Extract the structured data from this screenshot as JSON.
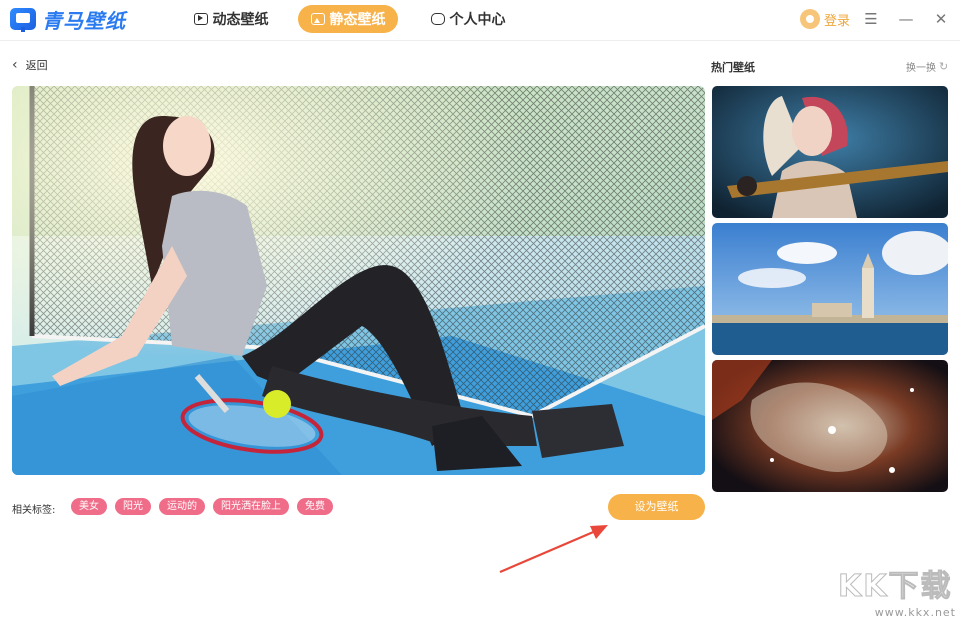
{
  "app": {
    "logo_text": "青马壁纸"
  },
  "nav": {
    "dynamic": "动态壁纸",
    "static": "静态壁纸",
    "user_center": "个人中心"
  },
  "header": {
    "login": "登录",
    "menu_glyph": "☰",
    "minimize_glyph": "—",
    "close_glyph": "✕"
  },
  "back": {
    "label": "返回",
    "glyph": "‹"
  },
  "preview": {
    "tags_label": "相关标签:",
    "tags": [
      "美女",
      "阳光",
      "运动的",
      "阳光洒在脸上",
      "免费"
    ],
    "set_button": "设为壁纸"
  },
  "hot": {
    "title": "热门壁纸",
    "refresh": "换一换",
    "refresh_glyph": "↻"
  },
  "watermark": {
    "big": "KK下载",
    "small": "www.kkx.net"
  },
  "colors": {
    "accent": "#f7b24a",
    "tag": "#f06d8a",
    "brand": "#2b7bf0",
    "arrow": "#e8473a"
  }
}
